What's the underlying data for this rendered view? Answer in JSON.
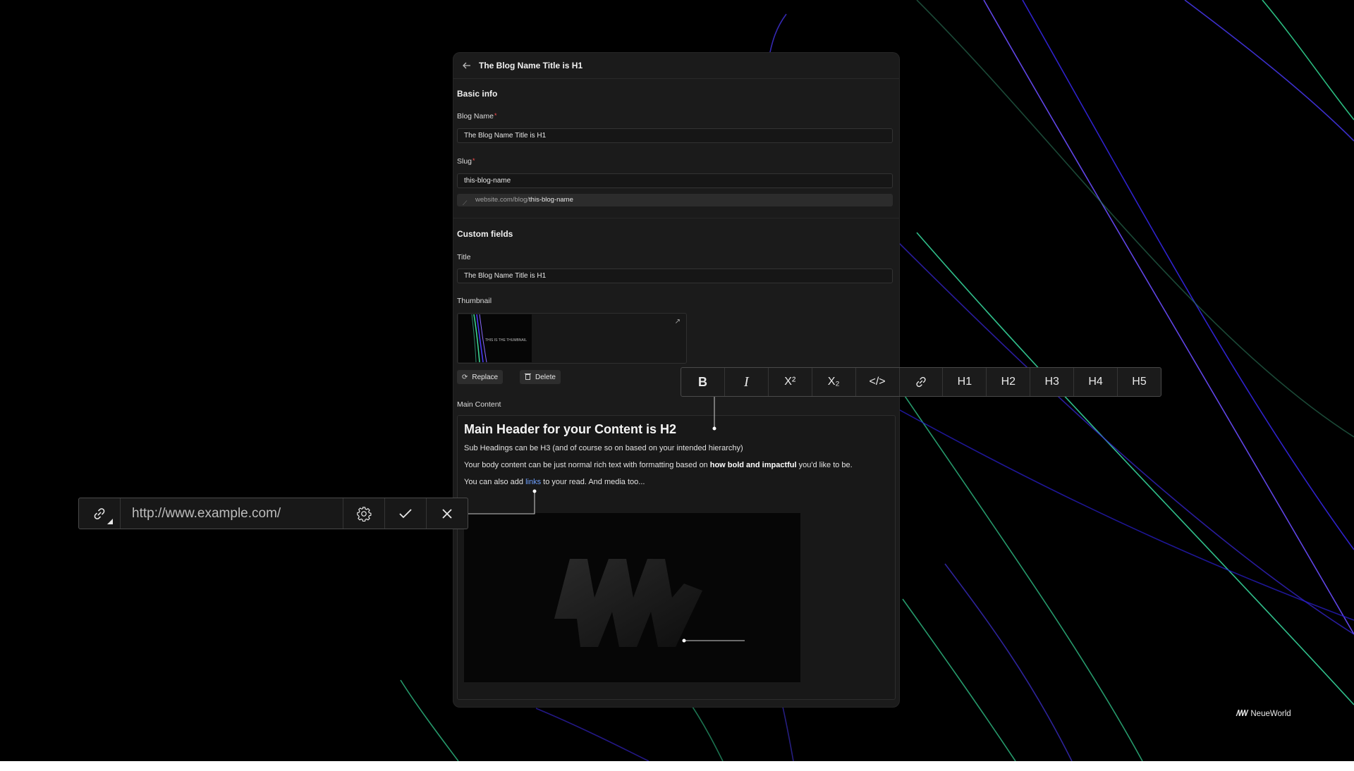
{
  "header": {
    "back_icon": "arrow-left-icon",
    "title": "The Blog Name Title is H1"
  },
  "basic_info": {
    "section_title": "Basic info",
    "blog_name_label": "Blog Name",
    "blog_name_value": "The Blog Name Title is H1",
    "slug_label": "Slug",
    "slug_value": "this-blog-name",
    "url_base": "website.com/blog/",
    "url_slug": "this-blog-name",
    "required_mark": "*"
  },
  "custom_fields": {
    "section_title": "Custom fields",
    "title_label": "Title",
    "title_value": "The Blog Name Title is H1",
    "thumbnail_label": "Thumbnail",
    "thumbnail_caption": "THIS IS THE THUMBNAIL",
    "replace_label": "Replace",
    "delete_label": "Delete"
  },
  "main_content": {
    "label": "Main Content",
    "heading": "Main Header for your Content is H2",
    "para1": "Sub Headings can be H3 (and of course so on based on your intended hierarchy)",
    "para2_before": "Your body content can be just normal rich text with formatting based on ",
    "para2_bold": "how bold and impactful",
    "para2_after": " you'd like to be.",
    "para3_before": "You can also add ",
    "para3_link": "links",
    "para3_after": " to your read. And media too..."
  },
  "toolbar": {
    "items": [
      {
        "label": "B",
        "icon": "bold-icon"
      },
      {
        "label": "I",
        "icon": "italic-icon"
      },
      {
        "label": "X²",
        "icon": "superscript-icon"
      },
      {
        "label": "X₂",
        "icon": "subscript-icon"
      },
      {
        "label": "</>",
        "icon": "code-icon"
      },
      {
        "label": "",
        "icon": "link-icon"
      },
      {
        "label": "H1",
        "icon": "heading1-icon"
      },
      {
        "label": "H2",
        "icon": "heading2-icon"
      },
      {
        "label": "H3",
        "icon": "heading3-icon"
      },
      {
        "label": "H4",
        "icon": "heading4-icon"
      },
      {
        "label": "H5",
        "icon": "heading5-icon"
      }
    ]
  },
  "link_editor": {
    "url": "http://www.example.com/",
    "icons": [
      "link-icon",
      "settings-gear-icon",
      "check-icon",
      "close-icon"
    ]
  },
  "brand": {
    "mark": "/\\/\\/\\/",
    "name": "NeueWorld"
  },
  "colors": {
    "background": "#000000",
    "panel": "#1b1b1b",
    "link": "#6ea0ff",
    "required": "#ff4d4d",
    "accent_green": "#3ddc97",
    "accent_blue": "#4b3bff"
  }
}
